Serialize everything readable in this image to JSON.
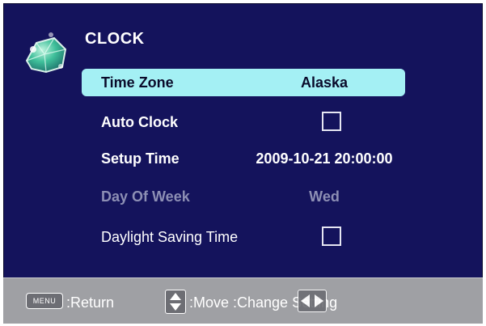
{
  "title": "CLOCK",
  "menu": {
    "items": [
      {
        "label": "Time Zone",
        "value": "Alaska",
        "state": "selected"
      },
      {
        "label": "Auto Clock",
        "checked": false
      },
      {
        "label": "Setup Time",
        "value": "2009-10-21 20:00:00"
      },
      {
        "label": "Day Of Week",
        "value": "Wed",
        "state": "disabled"
      },
      {
        "label": "Daylight Saving Time",
        "checked": false
      }
    ]
  },
  "footer": {
    "menu_key": "MENU",
    "return_text": ":Return",
    "move_text": ":Move :Change Setting"
  },
  "colors": {
    "background": "#14135c",
    "selected_row": "#a4f0f4",
    "footer": "#9fa0a4",
    "disabled_text": "#8d8fb4"
  },
  "icons": {
    "logo": "crystal-icon",
    "updown": "up-down-arrows-icon",
    "leftright": "left-right-arrows-icon"
  }
}
